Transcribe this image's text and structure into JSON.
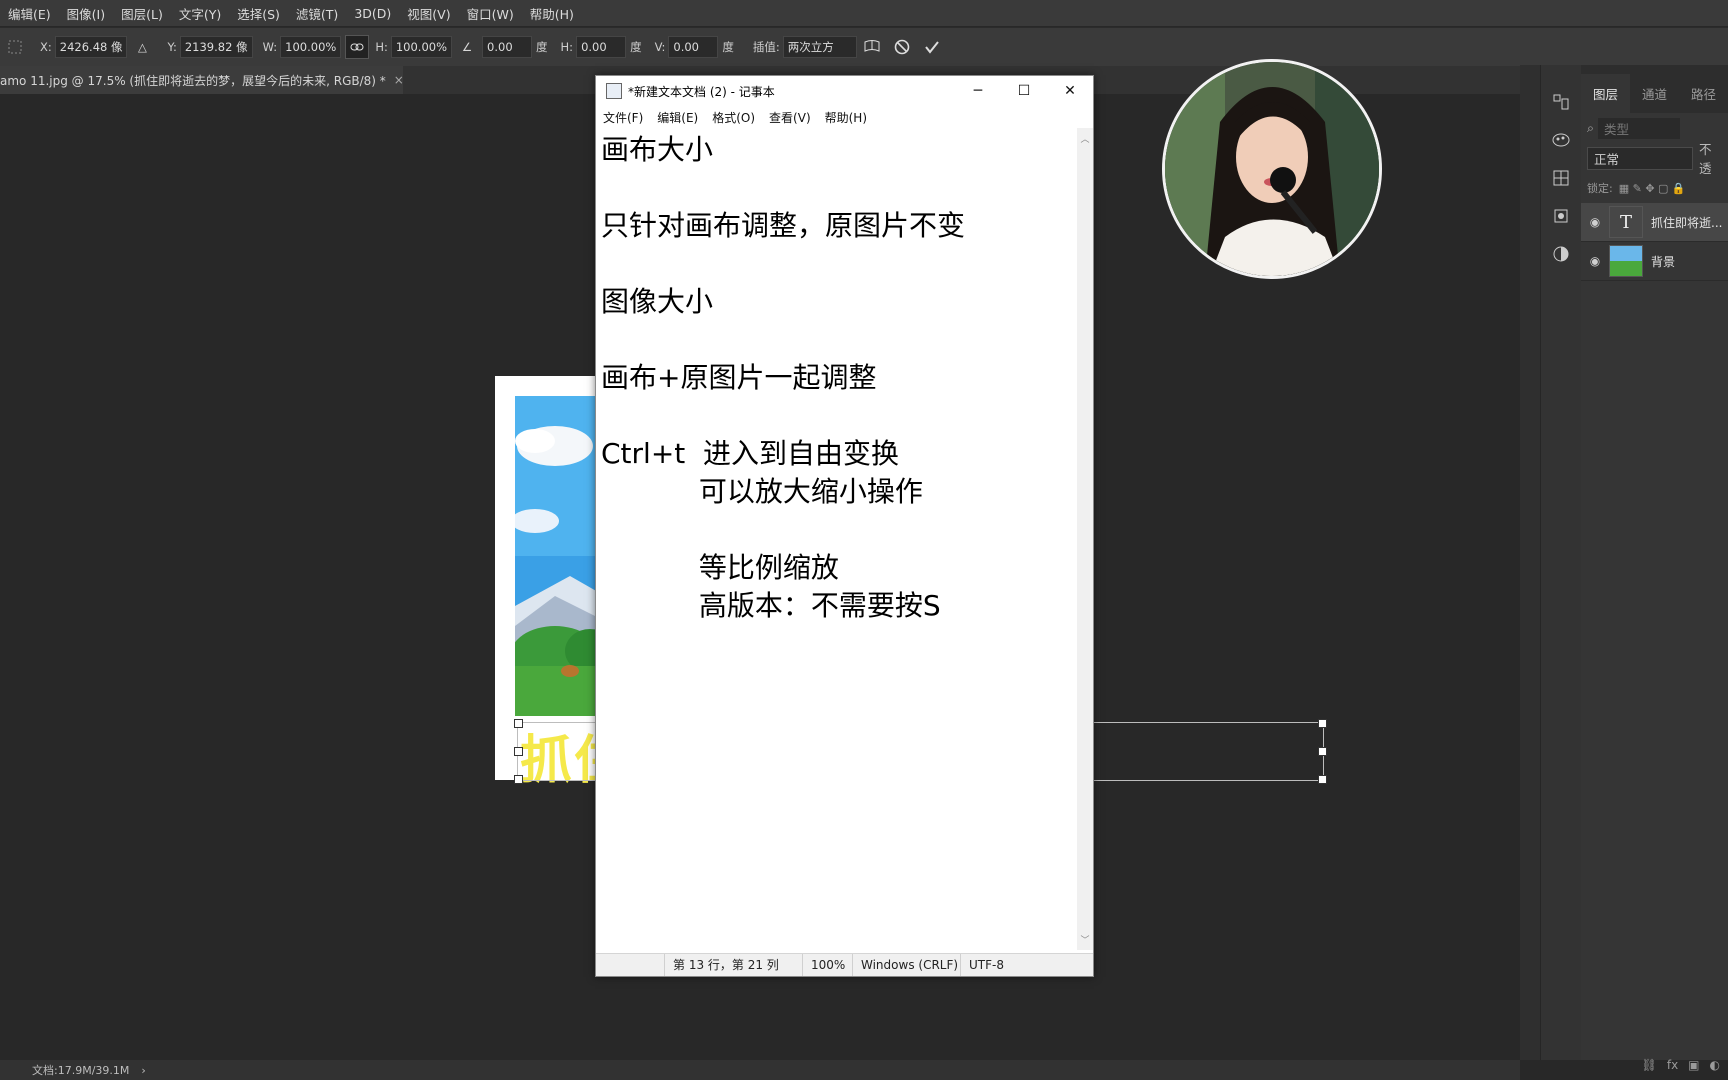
{
  "photoshop": {
    "menu": [
      "编辑(E)",
      "图像(I)",
      "图层(L)",
      "文字(Y)",
      "选择(S)",
      "滤镜(T)",
      "3D(D)",
      "视图(V)",
      "窗口(W)",
      "帮助(H)"
    ],
    "options": {
      "x_label": "X:",
      "x_value": "2426.48 像",
      "y_label": "Y:",
      "y_value": "2139.82 像",
      "w_label": "W:",
      "w_value": "100.00%",
      "h_label": "H:",
      "h_value": "100.00%",
      "angle_value": "0.00",
      "angle_unit": "度",
      "hskew_label": "H:",
      "hskew_value": "0.00",
      "hskew_unit": "度",
      "vskew_label": "V:",
      "vskew_value": "0.00",
      "vskew_unit": "度",
      "interp_label": "插值:",
      "interp_value": "两次立方"
    },
    "doc_tab": "amo 11.jpg @ 17.5% (抓住即将逝去的梦，展望今后的未来, RGB/8) *",
    "canvas_text": "抓住",
    "status": "文档:17.9M/39.1M",
    "layers_panel": {
      "tabs": [
        "图层",
        "通道",
        "路径"
      ],
      "search_placeholder": "类型",
      "blend_mode": "正常",
      "opacity_label": "不透",
      "lock_label": "锁定:",
      "layers": [
        {
          "name": "抓住即将逝...",
          "kind": "T"
        },
        {
          "name": "背景",
          "kind": "image"
        }
      ]
    }
  },
  "notepad": {
    "title": "*新建文本文档 (2) - 记事本",
    "menu": [
      "文件(F)",
      "编辑(E)",
      "格式(O)",
      "查看(V)",
      "帮助(H)"
    ],
    "lines": [
      "画布大小",
      "",
      "只针对画布调整，原图片不变",
      "",
      "图像大小",
      "",
      "画布+原图片一起调整",
      "",
      "Ctrl+t  进入到自由变换",
      "           可以放大缩小操作",
      "",
      "           等比例缩放",
      "           高版本：不需要按S"
    ],
    "status": {
      "position": "第 13 行，第 21 列",
      "zoom": "100%",
      "line_ending": "Windows (CRLF)",
      "encoding": "UTF-8"
    }
  },
  "colors": {
    "ps_bg": "#282828",
    "ps_panel": "#353535",
    "accent_text_yellow": "#f5e94a"
  }
}
